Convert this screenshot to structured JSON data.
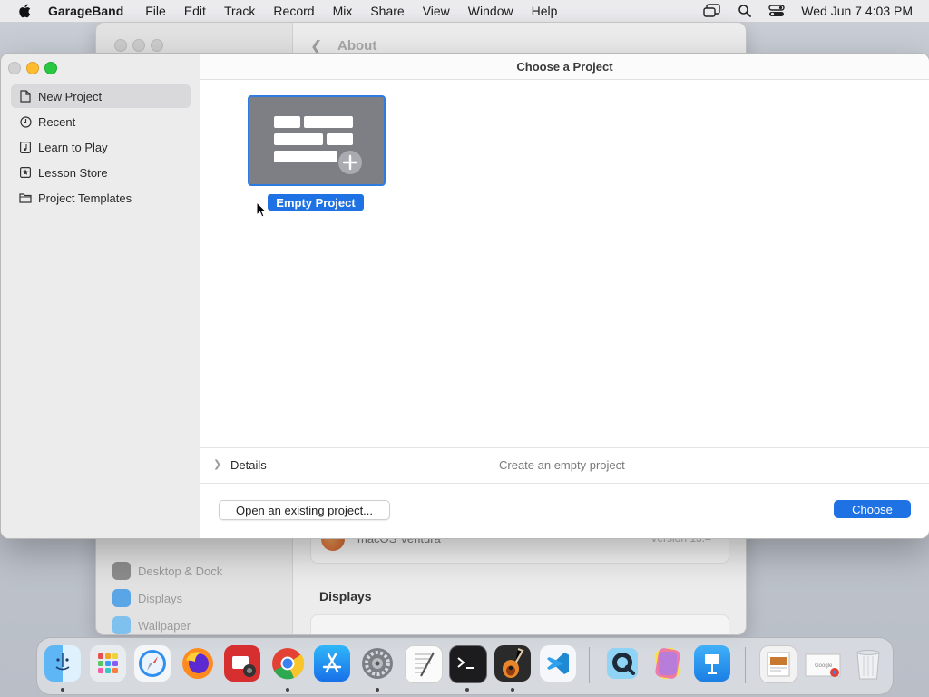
{
  "menubar": {
    "app_name": "GarageBand",
    "items": [
      "File",
      "Edit",
      "Track",
      "Record",
      "Mix",
      "Share",
      "View",
      "Window",
      "Help"
    ],
    "clock": "Wed Jun 7  4:03 PM"
  },
  "background_window": {
    "header_label": "About",
    "sidebar_items": [
      "Desktop & Dock",
      "Displays",
      "Wallpaper"
    ],
    "os_name": "macOS Ventura",
    "os_version": "Version 13.4",
    "section_heading": "Displays"
  },
  "dialog": {
    "title": "Choose a Project",
    "sidebar": [
      {
        "label": "New Project",
        "icon": "document-icon",
        "selected": true
      },
      {
        "label": "Recent",
        "icon": "clock-icon",
        "selected": false
      },
      {
        "label": "Learn to Play",
        "icon": "music-note-icon",
        "selected": false
      },
      {
        "label": "Lesson Store",
        "icon": "star-icon",
        "selected": false
      },
      {
        "label": "Project Templates",
        "icon": "folder-icon",
        "selected": false
      }
    ],
    "project": {
      "label": "Empty Project",
      "icon": "empty-project-icon"
    },
    "details": {
      "label": "Details",
      "description": "Create an empty project"
    },
    "open_button": "Open an existing project...",
    "choose_button": "Choose"
  },
  "dock": {
    "apps": [
      "Finder",
      "Launchpad",
      "Safari",
      "Firefox",
      "Photo Booth",
      "Chrome",
      "App Store",
      "System Settings",
      "TextEdit",
      "Terminal",
      "GarageBand",
      "Visual Studio Code",
      "QuickTime Player",
      "Pixelmator",
      "Keynote",
      "Downloads",
      "Google",
      "Trash"
    ]
  },
  "colors": {
    "accent": "#1f72e3",
    "tile_bg": "#7d7f85",
    "close": "#d1d1d1",
    "minimize": "#febc2e",
    "maximize": "#28c840"
  }
}
